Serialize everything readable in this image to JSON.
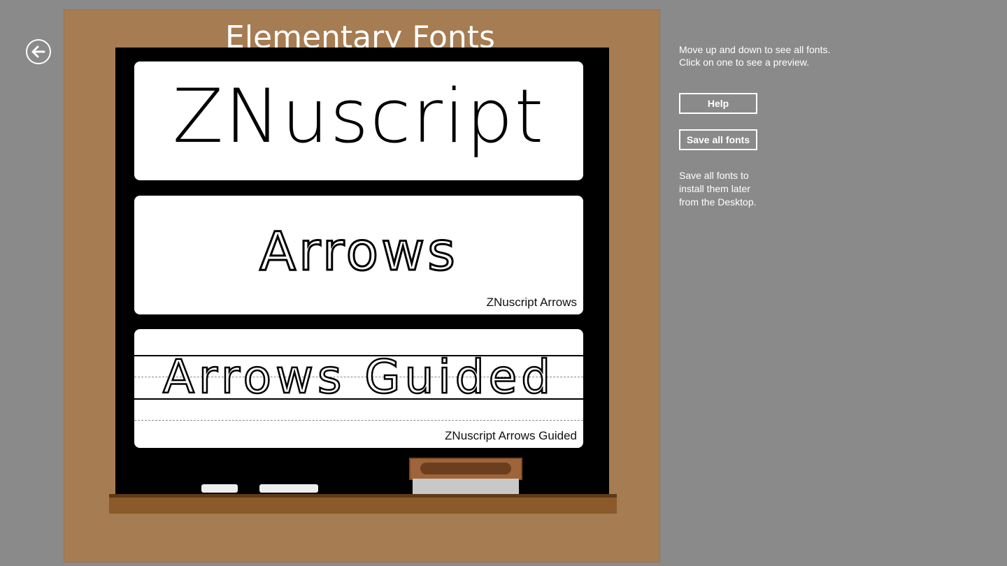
{
  "page": {
    "title": "Elementary Fonts",
    "back_icon": "back-arrow-icon"
  },
  "fonts": [
    {
      "sample": "ZNuscript",
      "caption": ""
    },
    {
      "sample": "Arrows",
      "caption": "ZNuscript Arrows"
    },
    {
      "sample": "Arrows Guided",
      "caption": "ZNuscript Arrows Guided"
    }
  ],
  "sidebar": {
    "instructions_line1": "Move up and down to see all fonts.",
    "instructions_line2": "Click on one to see a preview.",
    "help_label": "Help",
    "save_label": "Save all fonts",
    "note_line1": "Save all fonts to",
    "note_line2": "install them later",
    "note_line3": "from the Desktop."
  },
  "colors": {
    "background": "#8a8a8a",
    "panel": "#a67c52",
    "chalkboard": "#000000",
    "ledge": "#8a5a2b"
  }
}
